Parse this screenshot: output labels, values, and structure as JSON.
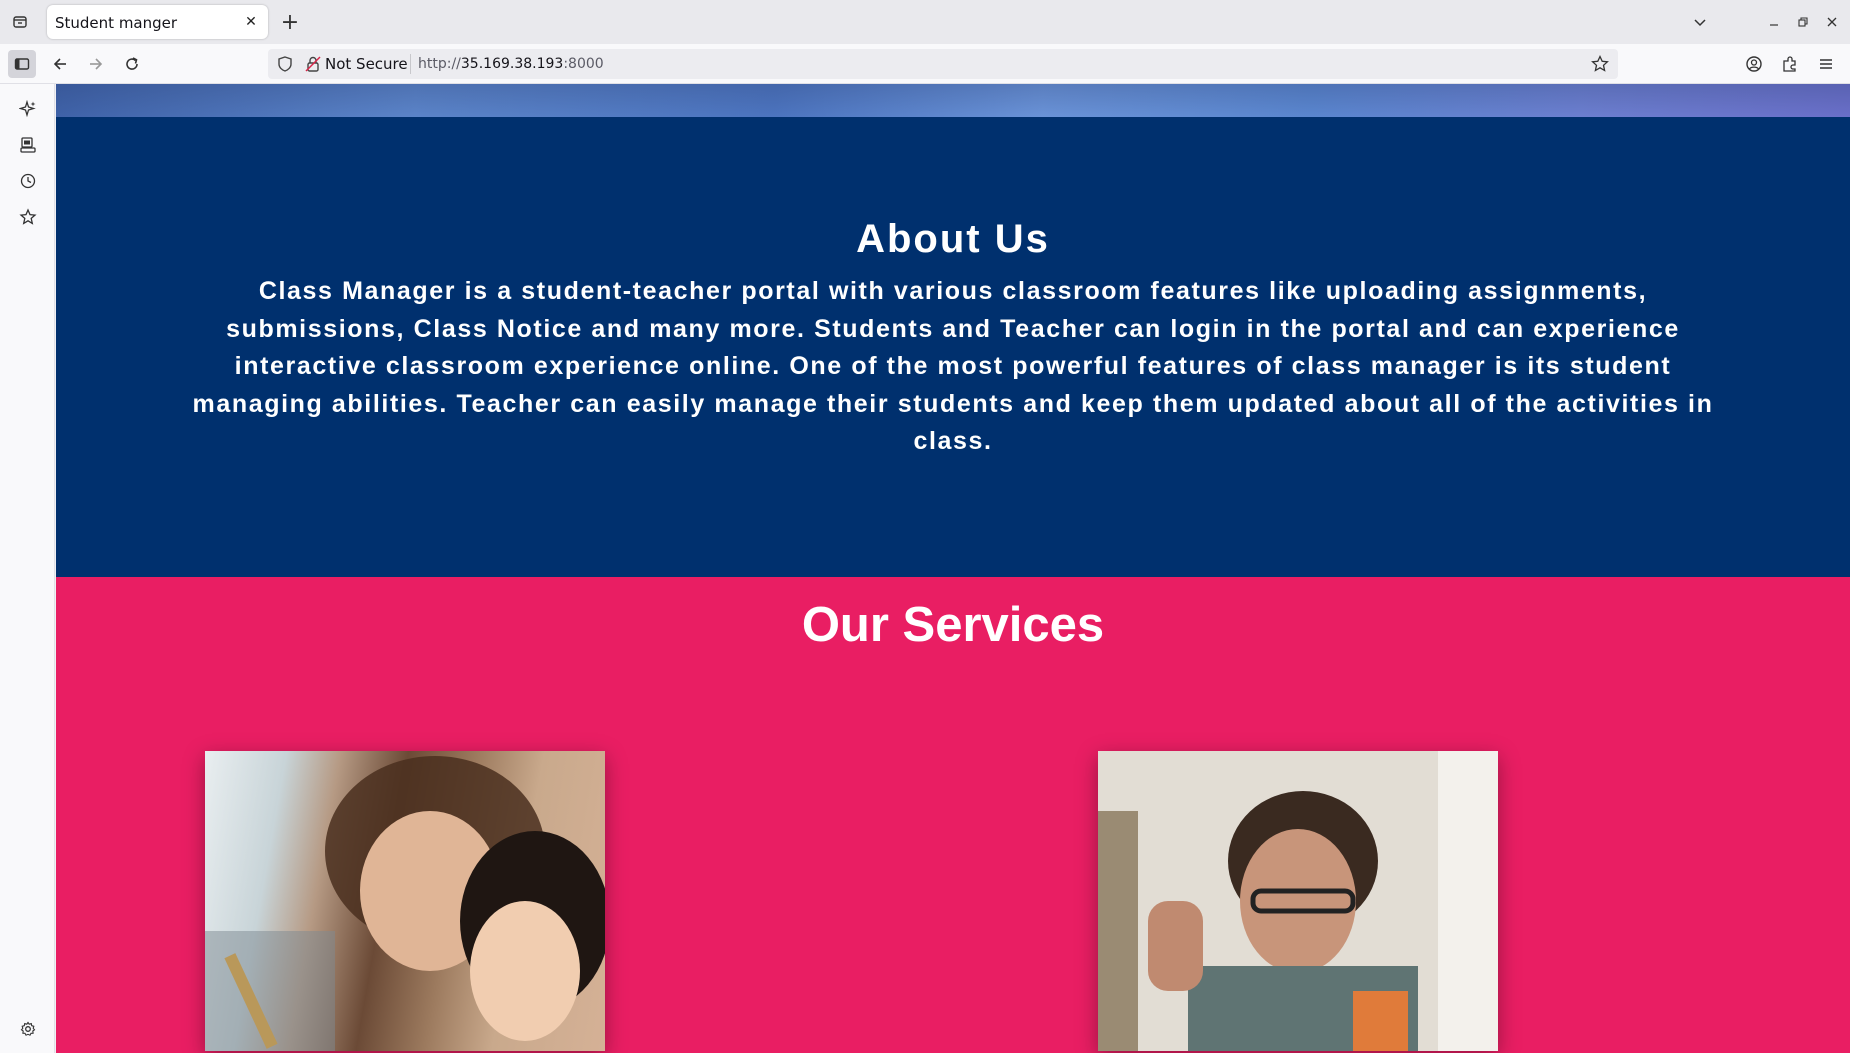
{
  "browser": {
    "tab_title": "Student manger",
    "tab_close_glyph": "✕",
    "new_tab_glyph": "+",
    "security_label": "Not Secure",
    "url_scheme": "http://",
    "url_host": "35.169.38.193",
    "url_port": ":8000"
  },
  "about": {
    "title": "About Us",
    "text": "Class Manager is a student-teacher portal with various classroom features like uploading assignments, submissions, Class Notice and many more. Students and Teacher can login in the portal and can experience interactive classroom experience online. One of the most powerful features of class manager is its student managing abilities. Teacher can easily manage their students and keep them updated about all of the activities in class."
  },
  "services": {
    "title": "Our Services"
  },
  "colors": {
    "about_bg": "#00306e",
    "services_bg": "#e91e63"
  },
  "icons": {
    "tab_list": "tab-list-icon",
    "sidebar_toggle": "sidebar-icon",
    "back": "back-arrow-icon",
    "forward": "forward-arrow-icon",
    "reload": "reload-icon",
    "shield": "shield-icon",
    "insecure_lock": "insecure-lock-icon",
    "bookmark": "star-icon",
    "account": "account-icon",
    "extensions": "puzzle-icon",
    "menu": "hamburger-menu-icon",
    "ai_chat": "sparkle-icon",
    "synced_tabs": "synced-tabs-icon",
    "history": "clock-icon",
    "bookmarks_sidebar": "star-icon",
    "settings": "gear-icon"
  }
}
